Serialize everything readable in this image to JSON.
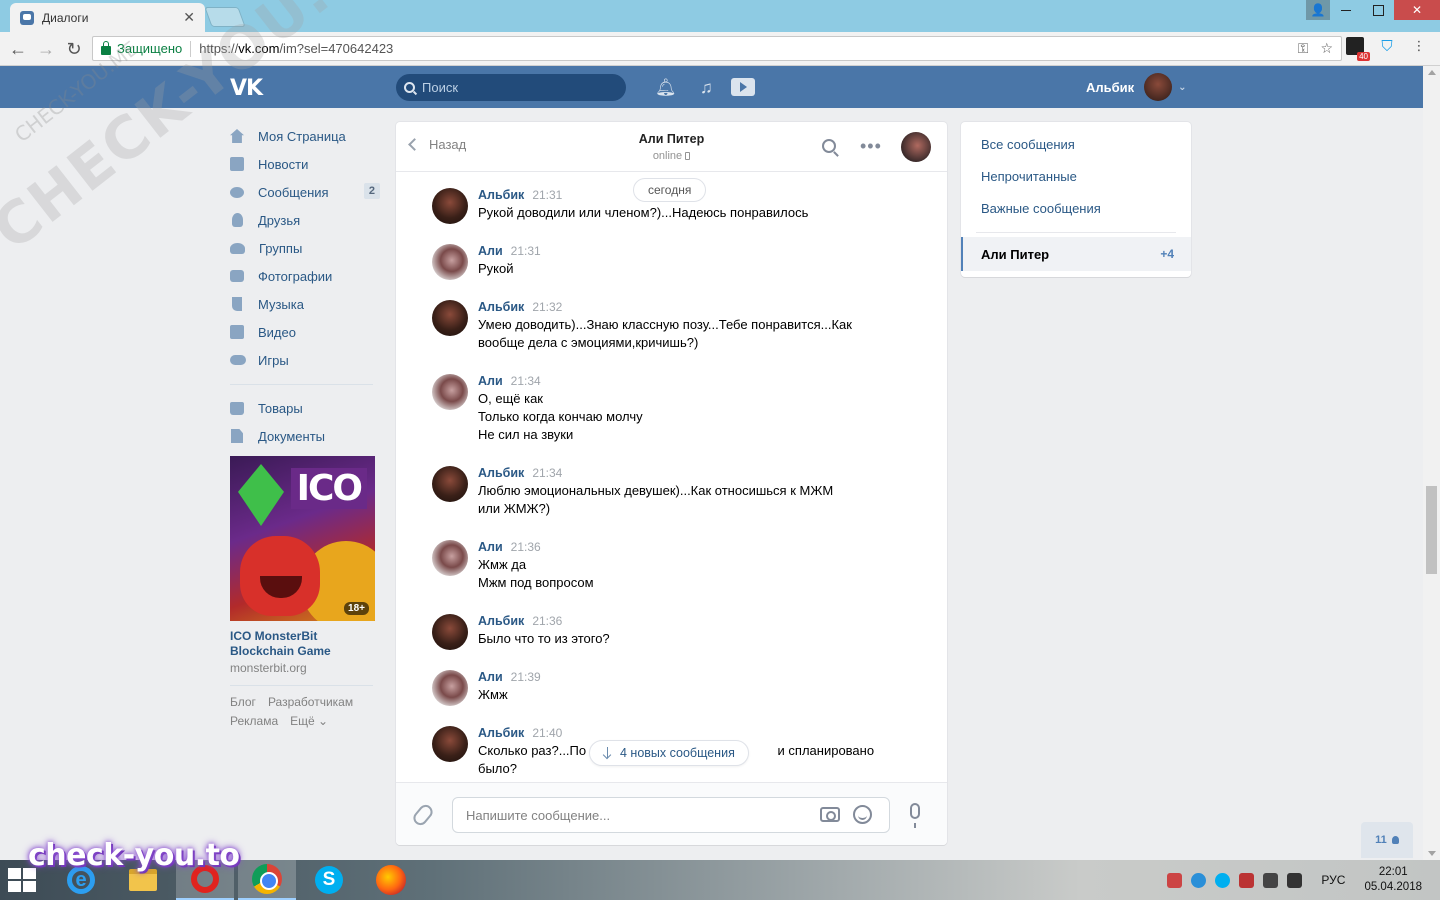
{
  "browser": {
    "tab_title": "Диалоги",
    "secure_label": "Защищено",
    "url_prefix": "https://",
    "url_host": "vk.com",
    "url_path": "/im?sel=470642423",
    "mail_badge": "40"
  },
  "header": {
    "search_placeholder": "Поиск",
    "user_name": "Альбик"
  },
  "leftnav": {
    "items": [
      {
        "label": "Моя Страница",
        "icon": "home-icon"
      },
      {
        "label": "Новости",
        "icon": "news-icon"
      },
      {
        "label": "Сообщения",
        "icon": "messages-icon",
        "badge": "2"
      },
      {
        "label": "Друзья",
        "icon": "friends-icon"
      },
      {
        "label": "Группы",
        "icon": "groups-icon"
      },
      {
        "label": "Фотографии",
        "icon": "photos-icon"
      },
      {
        "label": "Музыка",
        "icon": "music-icon"
      },
      {
        "label": "Видео",
        "icon": "video-icon"
      },
      {
        "label": "Игры",
        "icon": "games-icon"
      }
    ],
    "extra_items": [
      {
        "label": "Товары",
        "icon": "shop-icon"
      },
      {
        "label": "Документы",
        "icon": "documents-icon"
      }
    ],
    "ad": {
      "logo_text": "ICO",
      "age": "18+",
      "title": "ICO MonsterBit Blockchain Game",
      "domain": "monsterbit.org"
    },
    "footer_links": [
      "Блог",
      "Разработчикам",
      "Реклама",
      "Ещё ⌄"
    ]
  },
  "chat": {
    "back_label": "Назад",
    "peer_name": "Али Питер",
    "peer_status": "online",
    "date_label": "сегодня",
    "new_messages_label": "4 новых сообщения",
    "input_placeholder": "Напишите сообщение...",
    "messages": [
      {
        "author": "Альбик",
        "time": "21:31",
        "lines": [
          "Рукой доводили или членом?)...Надеюсь понравилось"
        ]
      },
      {
        "author": "Али",
        "time": "21:31",
        "lines": [
          "Рукой"
        ]
      },
      {
        "author": "Альбик",
        "time": "21:32",
        "lines": [
          "Умею доводить)...Знаю классную позу...Тебе понравится...Как",
          "вообще дела с эмоциями,кричишь?)"
        ]
      },
      {
        "author": "Али",
        "time": "21:34",
        "lines": [
          "О, ещё как",
          "Только когда кончаю молчу",
          "Не сил на звуки"
        ]
      },
      {
        "author": "Альбик",
        "time": "21:34",
        "lines": [
          "Люблю эмоциональных девушек)...Как относишься к МЖМ",
          "или ЖМЖ?)"
        ]
      },
      {
        "author": "Али",
        "time": "21:36",
        "lines": [
          "Жмж да",
          "Мжм под вопросом"
        ]
      },
      {
        "author": "Альбик",
        "time": "21:36",
        "lines": [
          "Было что то из этого?"
        ]
      },
      {
        "author": "Али",
        "time": "21:39",
        "lines": [
          "Жмж"
        ]
      },
      {
        "author": "Альбик",
        "time": "21:40",
        "lines": [
          "Сколько раз?...По                                                     и спланировано",
          "было?"
        ]
      }
    ]
  },
  "folders": {
    "items": [
      "Все сообщения",
      "Непрочитанные",
      "Важные сообщения"
    ],
    "active_name": "Али Питер",
    "active_count": "+4"
  },
  "online_count": "11",
  "watermark": {
    "diagonal": "CHECK-YOU.ME",
    "small": "CHECK-YOU.ME",
    "bottom": "check-you.to"
  },
  "taskbar": {
    "lang": "РУС",
    "time": "22:01",
    "date": "05.04.2018"
  }
}
